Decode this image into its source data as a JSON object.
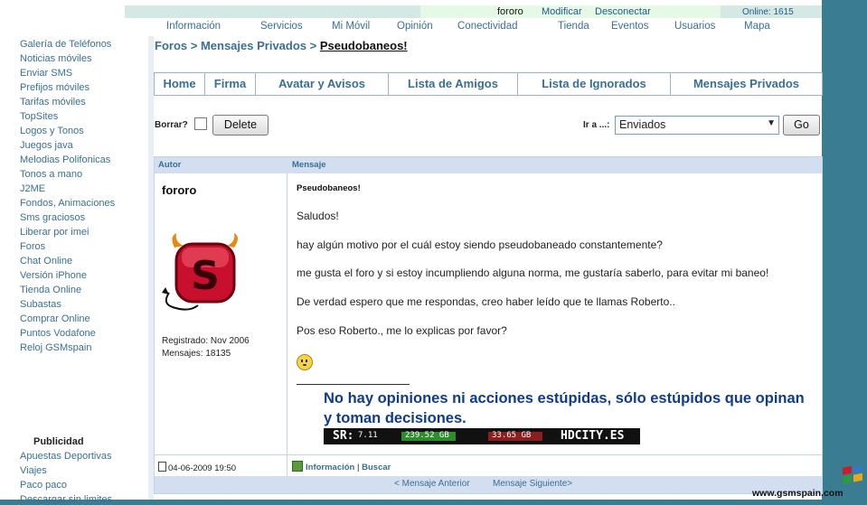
{
  "userbar": {
    "username": "fororo",
    "modify": "Modificar",
    "disconnect": "Desconectar",
    "online": "Online: 1615"
  },
  "topnav": [
    "Información",
    "Servicios",
    "Mi Móvil",
    "Opinión",
    "Conectividad",
    "Tienda",
    "Eventos",
    "Usuarios",
    "Mapa"
  ],
  "sidebar": {
    "items": [
      "Galería de Teléfonos",
      "Noticias móviles",
      "Enviar SMS",
      "Prefijos móviles",
      "Tarifas móviles",
      "TopSites",
      "Logos y Tonos",
      "Juegos java",
      "Melodias Polifonicas",
      "Tonos a mano",
      "J2ME",
      "Fondos, Animaciones",
      "Sms graciosos",
      "Liberar por imei",
      "Foros",
      "Chat Online",
      "Versión iPhone",
      "Tienda Online",
      "Subastas",
      "Comprar Online",
      "Puntos Vodafone",
      "Reloj GSMspain"
    ],
    "publicidad_title": "Publicidad",
    "publicidad_items": [
      "Apuestas Deportivas",
      "Viajes",
      "Paco paco",
      "Descargar sin limites"
    ]
  },
  "breadcrumb": {
    "foros": "Foros",
    "sep1": " > ",
    "mensajes": "Mensajes Privados",
    "sep2": " > ",
    "current": "Pseudobaneos!"
  },
  "tabs": [
    "Home",
    "Firma",
    "Avatar y Avisos",
    "Lista de Amigos",
    "Lista de Ignorados",
    "Mensajes Privados"
  ],
  "toolbar": {
    "borrar_label": "Borrar?",
    "delete_label": "Delete",
    "ira_label": "Ir a ...:",
    "select_value": "Enviados",
    "go_label": "Go"
  },
  "post": {
    "header_author": "Autor",
    "header_message": "Mensaje",
    "author": "fororo",
    "registered": "Registrado: Nov 2006",
    "messages": "Mensajes: 18135",
    "subject": "Pseudobaneos!",
    "lines": [
      "Saludos!",
      "hay algún motivo por el cuál estoy siendo pseudobaneado constantemente?",
      "me gusta el foro y si estoy incumpliendo alguna norma, me gustaría saberlo, para evitar mi baneo!",
      "De verdad espero que me respondas, creo haber leído que te llamas Roberto..",
      "Pos eso Roberto., me lo explicas por favor?"
    ],
    "signature": "No hay opiniones ni acciones estúpidas, sólo estúpidos que opinan y toman decisiones.",
    "banner": {
      "sr": "SR:",
      "sr_val": "7.11",
      "up": "239.52 GB",
      "down": "33.65 GB",
      "site": "HDCITY.ES"
    },
    "date": "04-06-2009 19:50",
    "info_link": "Información",
    "search_link": "Buscar",
    "divider": "|"
  },
  "pager": {
    "prev": "< Mensaje Anterior",
    "next": "Mensaje Siguiente>"
  },
  "watermark": "www.gsmspain.com",
  "colors": {
    "link": "#3a6f93",
    "header_bg": "#d3dff0",
    "signature": "#103b8c",
    "page_bg": "#3a7d93"
  }
}
